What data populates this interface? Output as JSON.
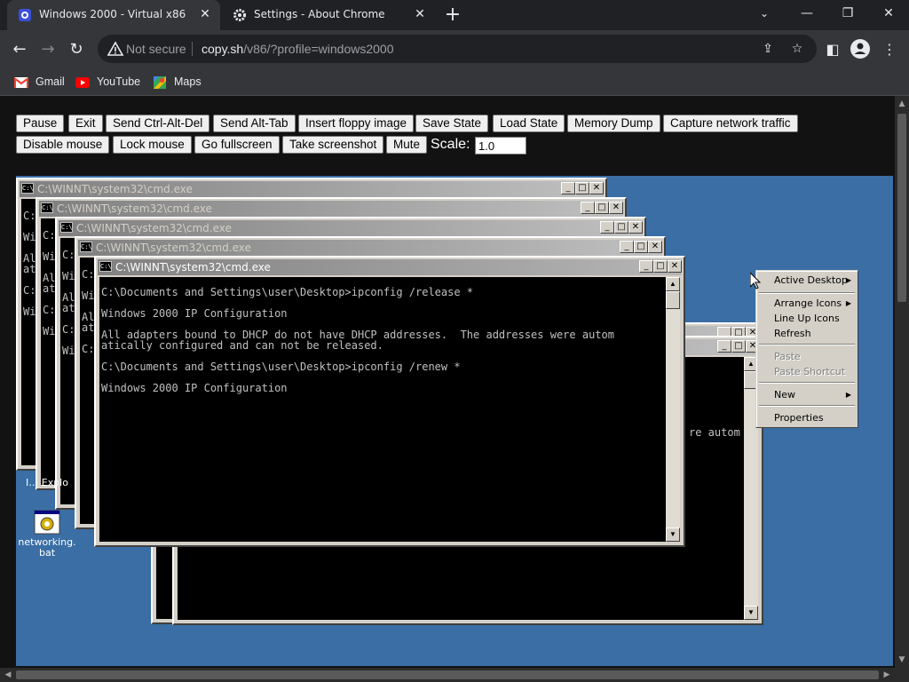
{
  "browser": {
    "tabs": [
      {
        "title": "Windows 2000 - Virtual x86",
        "icon": "v86-icon"
      },
      {
        "title": "Settings - About Chrome",
        "icon": "gear-icon"
      }
    ],
    "new_tab": "+",
    "window_controls": {
      "minimize": "—",
      "restore": "❐",
      "close": "✕"
    },
    "address": {
      "security_text": "Not secure",
      "host": "copy.sh",
      "path": "/v86/?profile=windows2000"
    },
    "bookmarks": [
      {
        "label": "Gmail",
        "icon": "gmail-icon"
      },
      {
        "label": "YouTube",
        "icon": "youtube-icon"
      },
      {
        "label": "Maps",
        "icon": "maps-icon"
      }
    ]
  },
  "controls": {
    "row1": [
      "Pause",
      "Exit",
      "Send Ctrl-Alt-Del",
      "Send Alt-Tab",
      "Insert floppy image",
      "Save State",
      "Load State",
      "Memory Dump",
      "Capture network traffic"
    ],
    "row2": [
      "Disable mouse",
      "Lock mouse",
      "Go fullscreen",
      "Take screenshot",
      "Mute"
    ],
    "scale_label": "Scale:",
    "scale_value": "1.0"
  },
  "emulator": {
    "window_title": "C:\\WINNT\\system32\\cmd.exe",
    "console_lines": [
      "C:\\Documents and Settings\\user\\Desktop>ipconfig /release *",
      "Windows 2000 IP Configuration",
      "All adapters bound to DHCP do not have DHCP addresses.  The addresses were autom",
      "atically configured and can not be released.",
      "C:\\Documents and Settings\\user\\Desktop>ipconfig /renew *",
      "Windows 2000 IP Configuration"
    ],
    "bg_fragments": {
      "w1": [
        "C:",
        "Wi",
        "Al",
        "at",
        "C:",
        "Wi"
      ],
      "w2": [
        "C:",
        "Wi",
        "Al",
        "at",
        "C:",
        "Wi"
      ],
      "w3": [
        "C:",
        "Wi",
        "Al",
        "at",
        "C:",
        "Wi"
      ],
      "w4": [
        "C:",
        "Wi",
        "Al",
        "at",
        "C:"
      ],
      "back": "re autom"
    },
    "desktop_icons": [
      {
        "label": "Internet Explorer",
        "partial": "I… Explo"
      },
      {
        "label": "networking.bat"
      }
    ],
    "context_menu": [
      {
        "label": "Active Desktop",
        "submenu": true,
        "enabled": true
      },
      {
        "label": "Arrange Icons",
        "submenu": true,
        "enabled": true
      },
      {
        "label": "Line Up Icons",
        "submenu": false,
        "enabled": true
      },
      {
        "label": "Refresh",
        "submenu": false,
        "enabled": true
      },
      {
        "label": "Paste",
        "submenu": false,
        "enabled": false
      },
      {
        "label": "Paste Shortcut",
        "submenu": false,
        "enabled": false
      },
      {
        "label": "New",
        "submenu": true,
        "enabled": true
      },
      {
        "label": "Properties",
        "submenu": false,
        "enabled": true
      }
    ]
  }
}
